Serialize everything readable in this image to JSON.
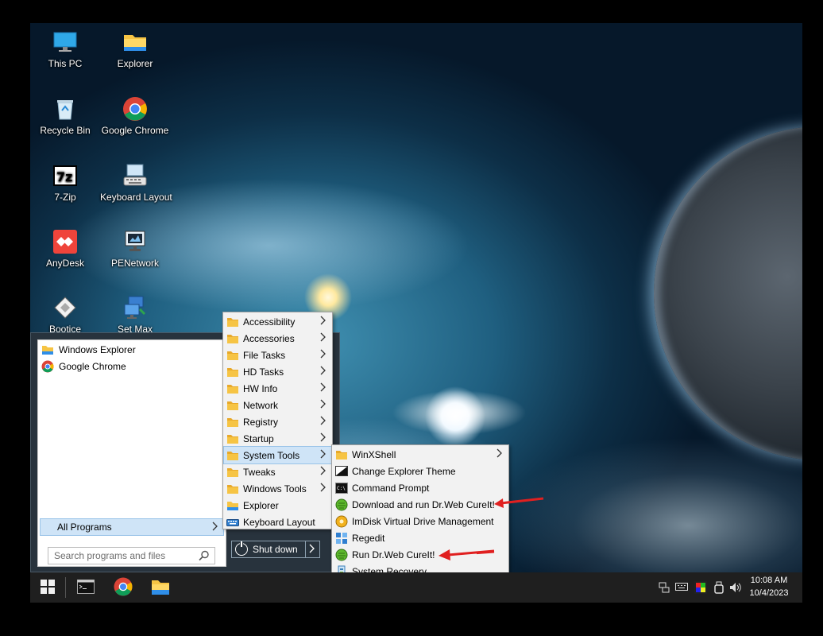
{
  "desktop_icons": [
    {
      "label": "This PC",
      "icon": "monitor-icon"
    },
    {
      "label": "Explorer",
      "icon": "folder-icon"
    },
    {
      "label": "Recycle Bin",
      "icon": "recycle-bin-icon"
    },
    {
      "label": "Google Chrome",
      "icon": "chrome-icon"
    },
    {
      "label": "7-Zip",
      "icon": "7zip-icon"
    },
    {
      "label": "Keyboard Layout",
      "icon": "keyboard-icon"
    },
    {
      "label": "AnyDesk",
      "icon": "anydesk-icon"
    },
    {
      "label": "PENetwork",
      "icon": "network-icon"
    },
    {
      "label": "Bootice",
      "icon": "bootice-icon"
    },
    {
      "label": "Set Max",
      "icon": "display-settings-icon"
    }
  ],
  "start_menu": {
    "pinned": [
      {
        "label": "Windows Explorer",
        "icon": "folder-icon"
      },
      {
        "label": "Google Chrome",
        "icon": "chrome-icon"
      }
    ],
    "all_programs_label": "All Programs",
    "search_placeholder": "Search programs and files",
    "shutdown_label": "Shut down"
  },
  "programs_menu": [
    {
      "label": "Accessibility",
      "icon": "folder-icon",
      "submenu": true
    },
    {
      "label": "Accessories",
      "icon": "folder-icon",
      "submenu": true
    },
    {
      "label": "File Tasks",
      "icon": "folder-icon",
      "submenu": true
    },
    {
      "label": "HD Tasks",
      "icon": "folder-icon",
      "submenu": true
    },
    {
      "label": "HW Info",
      "icon": "folder-icon",
      "submenu": true
    },
    {
      "label": "Network",
      "icon": "folder-icon",
      "submenu": true
    },
    {
      "label": "Registry",
      "icon": "folder-icon",
      "submenu": true
    },
    {
      "label": "Startup",
      "icon": "folder-icon",
      "submenu": true
    },
    {
      "label": "System Tools",
      "icon": "folder-icon",
      "submenu": true,
      "selected": true
    },
    {
      "label": "Tweaks",
      "icon": "folder-icon",
      "submenu": true
    },
    {
      "label": "Windows Tools",
      "icon": "folder-icon",
      "submenu": true
    },
    {
      "label": "Explorer",
      "icon": "explorer-icon",
      "submenu": false
    },
    {
      "label": "Keyboard Layout",
      "icon": "keyboard-icon",
      "submenu": false
    }
  ],
  "system_tools_menu": [
    {
      "label": "WinXShell",
      "icon": "folder-icon",
      "submenu": true
    },
    {
      "label": "Change Explorer Theme",
      "icon": "theme-icon",
      "submenu": false
    },
    {
      "label": "Command Prompt",
      "icon": "cmd-icon",
      "submenu": false
    },
    {
      "label": "Download and run Dr.Web CureIt!",
      "icon": "drweb-icon",
      "submenu": false
    },
    {
      "label": "ImDisk Virtual Drive Management",
      "icon": "imdisk-icon",
      "submenu": false
    },
    {
      "label": "Regedit",
      "icon": "regedit-icon",
      "submenu": false
    },
    {
      "label": "Run Dr.Web CureIt!",
      "icon": "drweb-icon",
      "submenu": false
    },
    {
      "label": "System Recovery",
      "icon": "system-recovery-icon",
      "submenu": false
    }
  ],
  "taskbar": {
    "apps": [
      "start-icon",
      "terminal-icon",
      "chrome-icon",
      "explorer-icon"
    ],
    "tray_icons": [
      "network-icon",
      "keyboard-icon",
      "color-icon",
      "usb-icon",
      "volume-icon"
    ],
    "time": "10:08 AM",
    "date": "10/4/2023"
  },
  "colors": {
    "menu_highlight": "#cfe4f7",
    "taskbar": "#1f1f1f",
    "start_menu_bg": "#28333d",
    "annotation_arrow": "#e02020"
  }
}
